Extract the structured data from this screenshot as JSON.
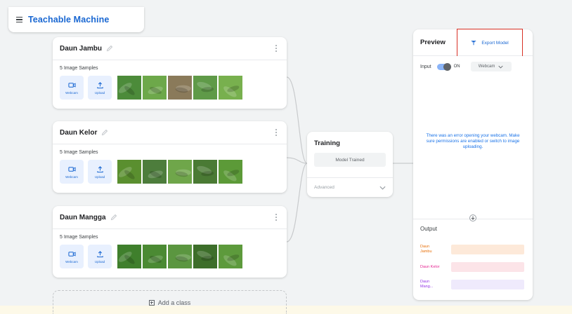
{
  "app": {
    "title": "Teachable Machine"
  },
  "classes": [
    {
      "name": "Daun Jambu",
      "samples": "5 Image Samples",
      "webcam_label": "Webcam",
      "upload_label": "Upload",
      "thumb_colors": [
        "#4c8b3a",
        "#6da84a",
        "#8a7a5a",
        "#5f9a48",
        "#78b04e"
      ]
    },
    {
      "name": "Daun Kelor",
      "samples": "5 Image Samples",
      "webcam_label": "Webcam",
      "upload_label": "Upload",
      "thumb_colors": [
        "#5a8f2f",
        "#4d7d3c",
        "#6fa64a",
        "#4a7a34",
        "#5c9a38"
      ]
    },
    {
      "name": "Daun Mangga",
      "samples": "5 Image Samples",
      "webcam_label": "Webcam",
      "upload_label": "Upload",
      "thumb_colors": [
        "#3f7f2c",
        "#4b8a33",
        "#5b9640",
        "#3d6e2a",
        "#5d9a3c"
      ]
    }
  ],
  "add_class_label": "Add a class",
  "training": {
    "title": "Training",
    "status_button": "Model Trained",
    "advanced_label": "Advanced"
  },
  "preview": {
    "title": "Preview",
    "export_label": "Export Model",
    "input_label": "Input",
    "toggle_state": "ON",
    "input_source": "Webcam",
    "error_message": "There was an error opening your webcam. Make sure permissions are enabled or switch to image uploading.",
    "output_title": "Output",
    "outputs": [
      {
        "label": "Daun Jambu",
        "color": "#e8710a",
        "bar": "#fde9d9"
      },
      {
        "label": "Daun Kelor",
        "color": "#e52592",
        "bar": "#fce4e8"
      },
      {
        "label": "Daun Mang...",
        "color": "#9334e6",
        "bar": "#efeafc"
      }
    ]
  },
  "colors": {
    "accent": "#1967d2",
    "highlight_box": "#d93025"
  }
}
